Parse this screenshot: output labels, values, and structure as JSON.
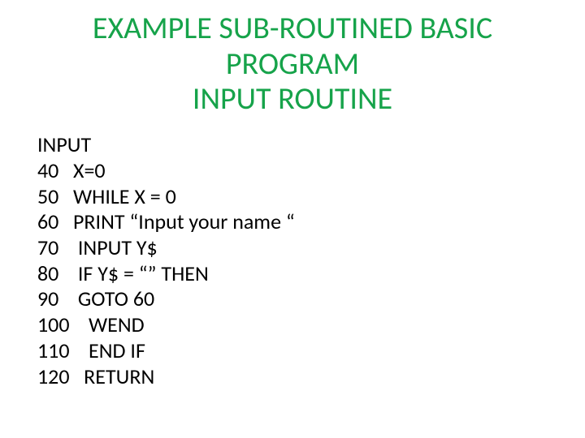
{
  "title": {
    "line1": "EXAMPLE SUB-ROUTINED BASIC",
    "line2": "PROGRAM",
    "line3": "INPUT ROUTINE"
  },
  "code": {
    "header": "INPUT",
    "lines": [
      "40   X=0",
      "50   WHILE X = 0",
      "60   PRINT “Input your name “",
      "70    INPUT Y$",
      "80    IF Y$ = “” THEN",
      "90    GOTO 60",
      "100    WEND",
      "110    END IF",
      "120   RETURN"
    ]
  }
}
